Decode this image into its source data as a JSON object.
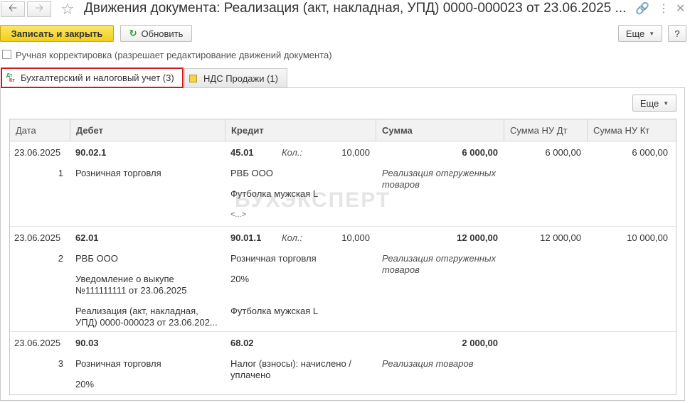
{
  "window": {
    "title": "Движения документа: Реализация (акт, накладная, УПД) 0000-000023 от 23.06.2025 ...",
    "back_icon": "arrow-left-icon",
    "forward_icon": "arrow-right-icon",
    "favorite_icon": "star-icon",
    "link_icon": "link-icon",
    "menu_icon": "more-vertical-icon",
    "close_icon": "close-icon"
  },
  "toolbar": {
    "save_close_label": "Записать и закрыть",
    "refresh_label": "Обновить",
    "more_label": "Еще",
    "help_label": "?"
  },
  "manual_edit": {
    "label": "Ручная корректировка (разрешает редактирование движений документа)",
    "checked": false
  },
  "tabs": [
    {
      "label": "Бухгалтерский и налоговый учет (3)",
      "icon_top": "Дт",
      "icon_bottom": "Кт",
      "active": true
    },
    {
      "label": "НДС Продажи (1)",
      "icon": "register-icon",
      "active": false
    }
  ],
  "table_toolbar": {
    "more_label": "Еще"
  },
  "columns": [
    "Дата",
    "Дебет",
    "Кредит",
    "Сумма",
    "Сумма НУ Дт",
    "Сумма НУ Кт"
  ],
  "qty_label": "Кол.:",
  "rows": [
    {
      "date": "23.06.2025",
      "num": "1",
      "debit_account": "90.02.1",
      "debit_lines": [
        "Розничная торговля"
      ],
      "credit_account": "45.01",
      "qty": "10,000",
      "credit_lines": [
        "РВБ ООО",
        "Футболка мужская L",
        "<...>"
      ],
      "sum": "6 000,00",
      "content": "Реализация отгруженных товаров",
      "nu_dt": "6 000,00",
      "nu_kt": "6 000,00"
    },
    {
      "date": "23.06.2025",
      "num": "2",
      "debit_account": "62.01",
      "debit_lines": [
        "РВБ ООО",
        "Уведомление о выкупе №111111111 от 23.06.2025",
        "Реализация (акт, накладная, УПД) 0000-000023 от 23.06.202..."
      ],
      "credit_account": "90.01.1",
      "qty": "10,000",
      "credit_lines": [
        "Розничная торговля",
        "20%",
        "Футболка мужская L"
      ],
      "sum": "12 000,00",
      "content": "Реализация отгруженных товаров",
      "nu_dt": "12 000,00",
      "nu_kt": "10 000,00"
    },
    {
      "date": "23.06.2025",
      "num": "3",
      "debit_account": "90.03",
      "debit_lines": [
        "Розничная торговля",
        "20%"
      ],
      "credit_account": "68.02",
      "credit_lines": [
        "Налог (взносы): начислено / уплачено"
      ],
      "sum": "2 000,00",
      "content": "Реализация товаров",
      "nu_dt": "",
      "nu_kt": ""
    }
  ],
  "watermark": "БУХЭКСПЕРТ"
}
